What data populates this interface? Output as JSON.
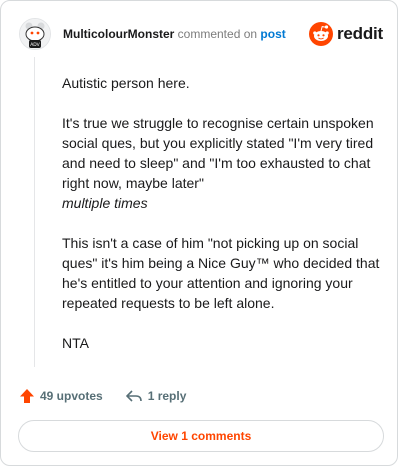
{
  "comment": {
    "username": "MulticolourMonster",
    "action_text": "commented on",
    "post_link": "post",
    "brand": "reddit",
    "paragraphs": [
      "Autistic person here.",
      "It's true we struggle to recognise certain unspoken social ques, but you explicitly stated \"I'm very tired and need to sleep\" and \"I'm too exhausted to chat right now, maybe later\"",
      "multiple times",
      "This isn't a case of him \"not picking up on social ques\" it's him being a Nice Guy™ who decided that he's entitled to your attention and ignoring your repeated requests to be left alone.",
      "NTA"
    ]
  },
  "actions": {
    "upvotes": "49 upvotes",
    "replies": "1 reply"
  },
  "footer": {
    "view_comments": "View 1 comments"
  },
  "colors": {
    "brand_orange": "#ff4500",
    "link_blue": "#0079d3",
    "muted": "#576f76"
  },
  "icons": [
    "avatar-snoo-icon",
    "reddit-logo-icon",
    "upvote-arrow-icon",
    "reply-icon"
  ]
}
